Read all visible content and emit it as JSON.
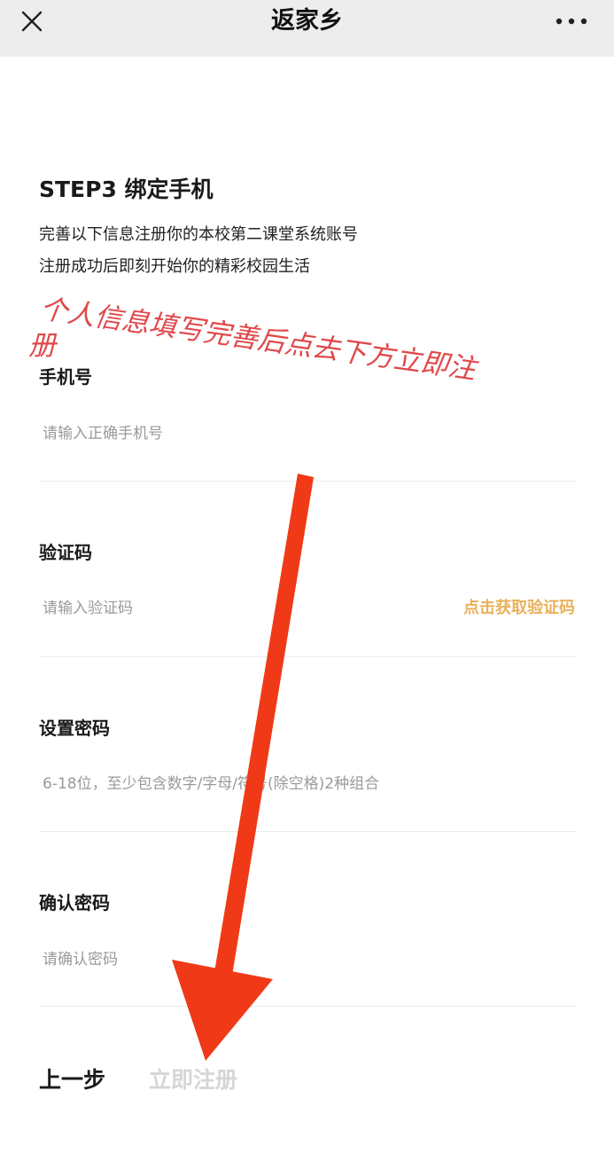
{
  "nav": {
    "title": "返家乡",
    "close_icon": "close-icon",
    "more_icon": "more-dots-icon"
  },
  "step": {
    "title": "STEP3 绑定手机",
    "desc_line1": "完善以下信息注册你的本校第二课堂系统账号",
    "desc_line2": "注册成功后即刻开始你的精彩校园生活"
  },
  "fields": {
    "phone": {
      "label": "手机号",
      "placeholder": "请输入正确手机号",
      "value": ""
    },
    "code": {
      "label": "验证码",
      "placeholder": "请输入验证码",
      "value": "",
      "action_label": "点击获取验证码"
    },
    "password": {
      "label": "设置密码",
      "placeholder": "6-18位，至少包含数字/字母/符号(除空格)2种组合",
      "value": ""
    },
    "confirm": {
      "label": "确认密码",
      "placeholder": "请确认密码",
      "value": ""
    }
  },
  "actions": {
    "prev_label": "上一步",
    "register_label": "立即注册"
  },
  "annotation": {
    "line1": "个人信息填写完善后点去下方立即注",
    "line2": "册",
    "color": "#e0484a",
    "arrow_color": "#f03a17"
  },
  "colors": {
    "accent": "#e8b25a",
    "nav_bg": "#ededed",
    "disabled": "#d6d6d6"
  }
}
